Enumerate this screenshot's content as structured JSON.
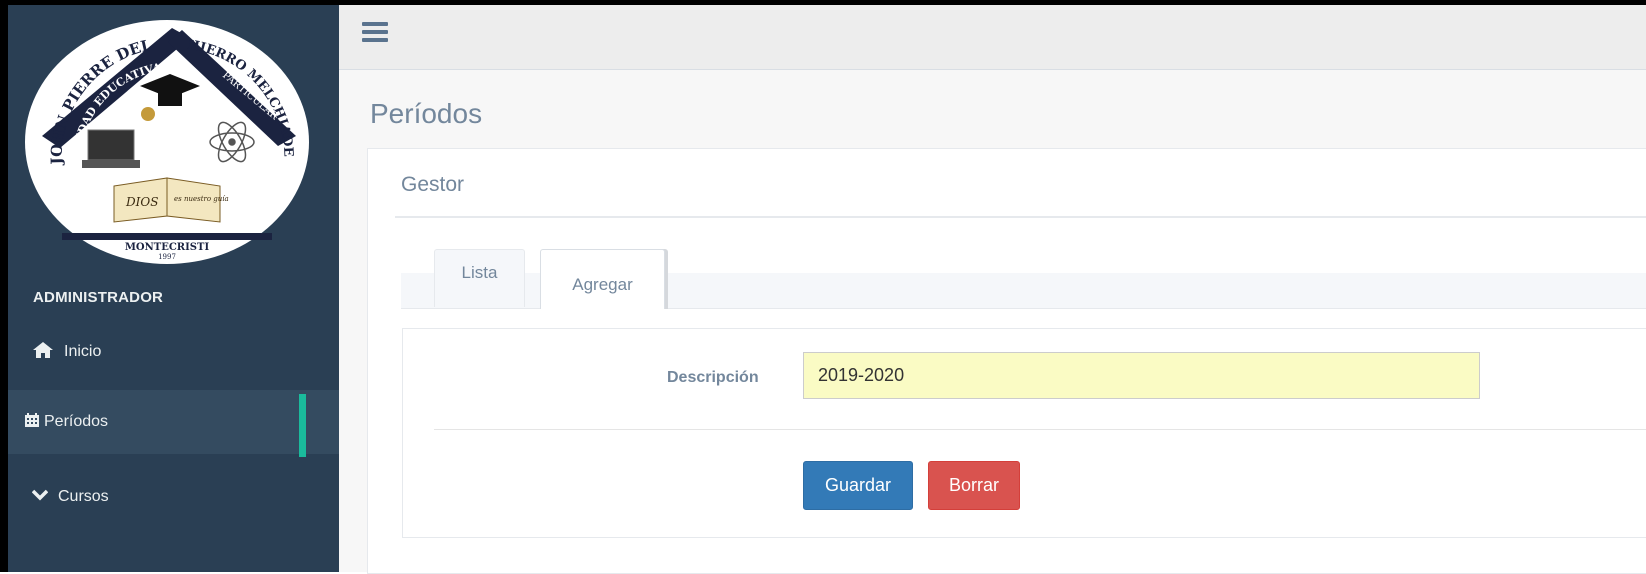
{
  "sidebar": {
    "logo": {
      "top_arc": "UNIDAD EDUCATIVA",
      "name_arc_left": "JOHN PIERRE DEL",
      "name_arc_right": "HIERRO MELCHIADE",
      "particular": "PARTICULAR",
      "book_left": "DIOS",
      "book_right": "es nuestro guía",
      "ribbon": "MONTECRISTI",
      "year": "1997"
    },
    "role": "ADMINISTRADOR",
    "items": [
      {
        "label": "Inicio",
        "icon": "home-icon"
      },
      {
        "label": "Períodos",
        "icon": "calendar-icon",
        "active": true
      },
      {
        "label": "Cursos",
        "icon": "chevron-down-icon"
      }
    ]
  },
  "topbar": {
    "menu_icon": "hamburger-icon"
  },
  "page": {
    "title": "Períodos"
  },
  "panel": {
    "title": "Gestor",
    "tabs": [
      {
        "label": "Lista"
      },
      {
        "label": "Agregar",
        "active": true
      }
    ],
    "form": {
      "description_label": "Descripción",
      "description_value": "2019-2020"
    },
    "buttons": {
      "save": "Guardar",
      "clear": "Borrar"
    }
  },
  "colors": {
    "sidebar_bg": "#2a3f54",
    "active_accent": "#1abb9c",
    "primary_button": "#337ab7",
    "danger_button": "#d9534f",
    "input_highlight": "#fafbc4"
  }
}
